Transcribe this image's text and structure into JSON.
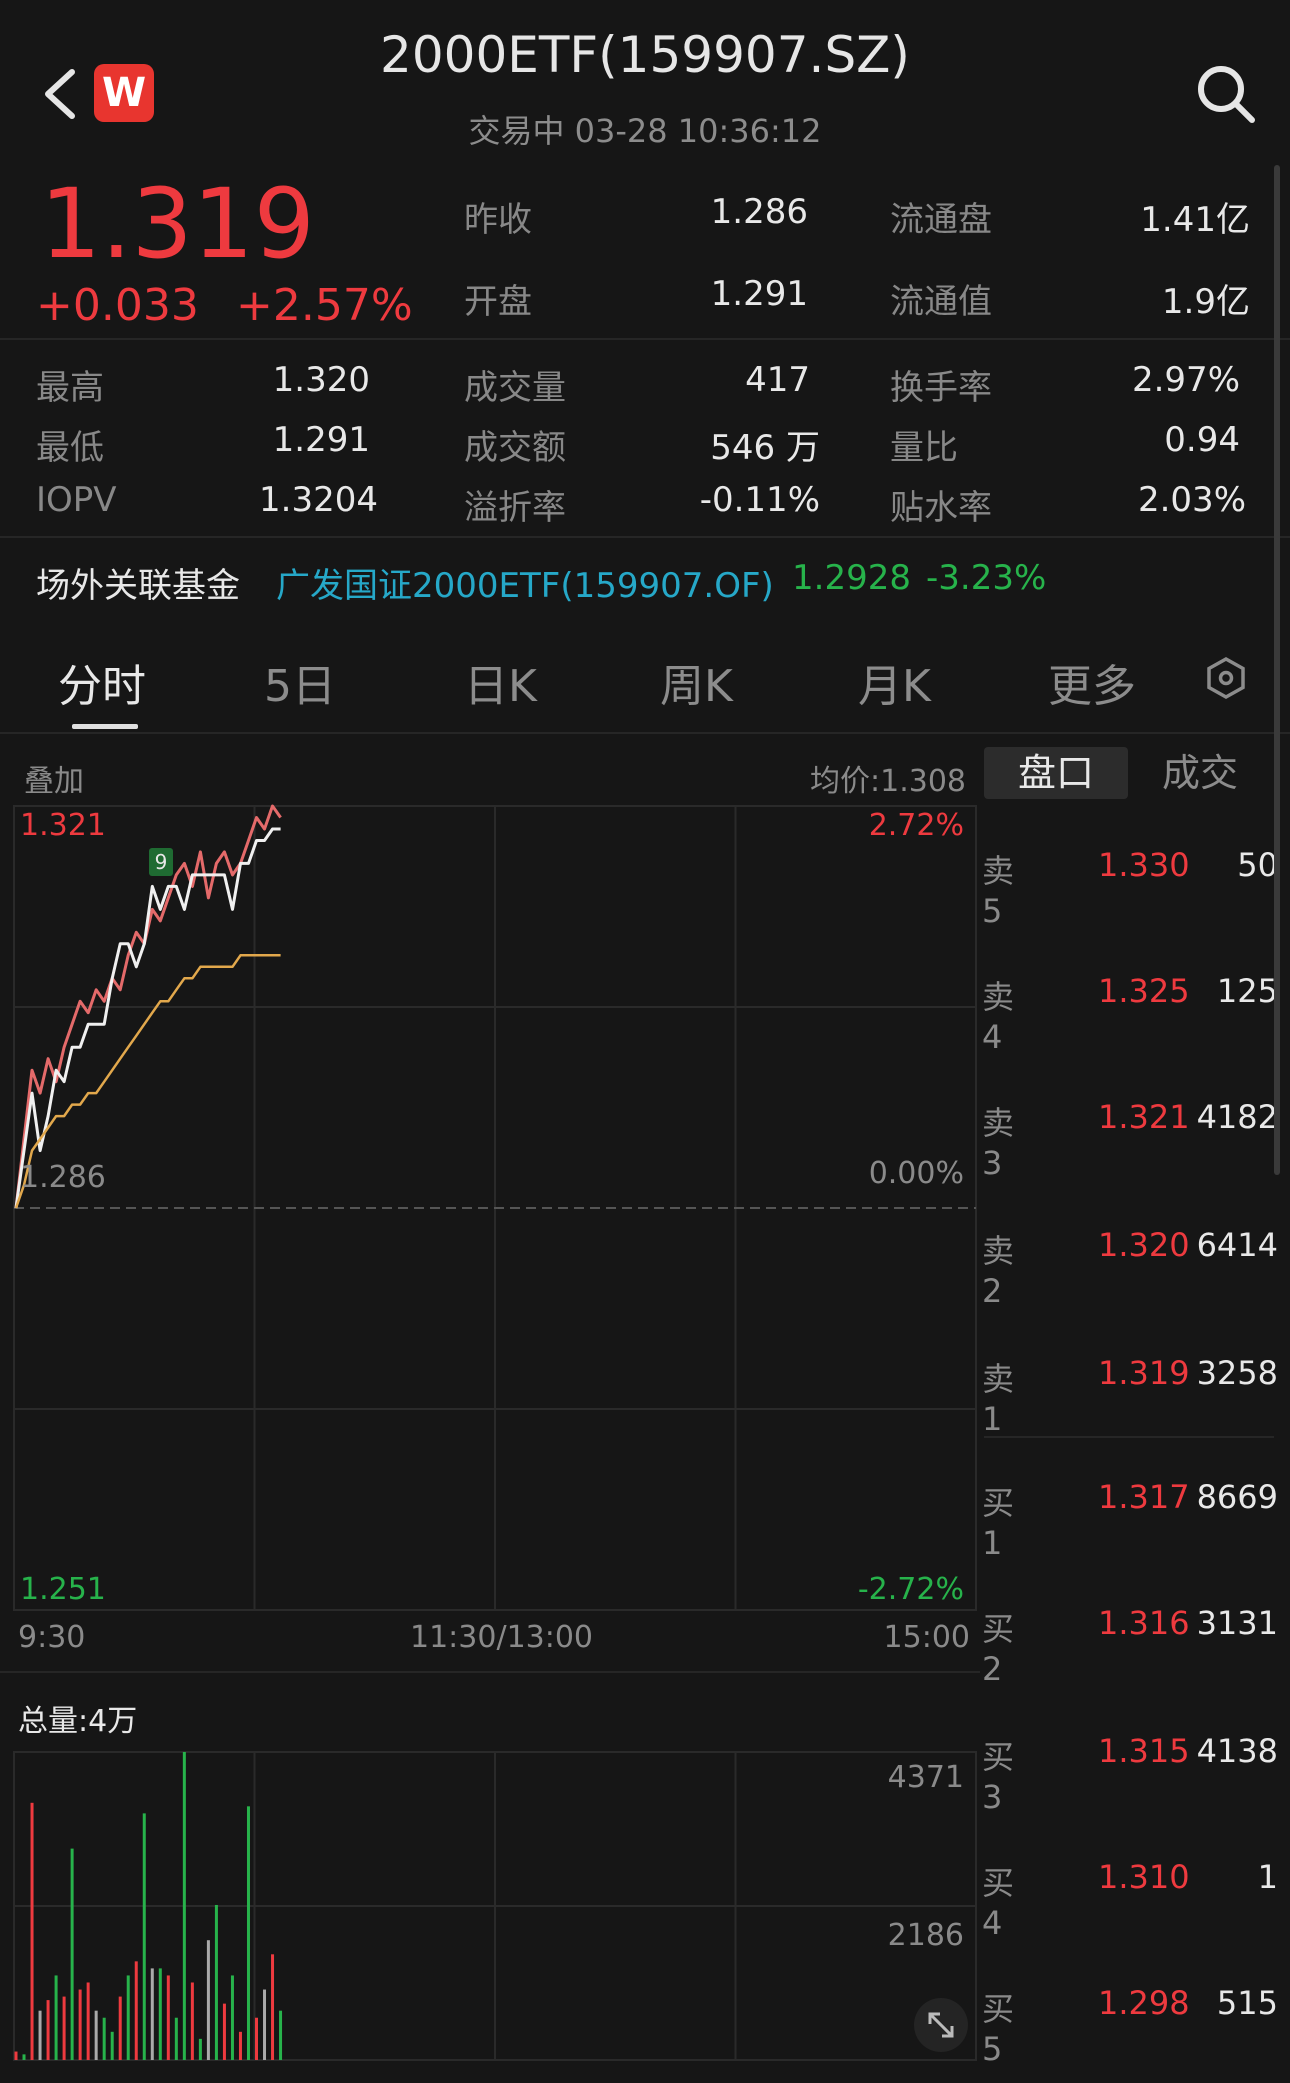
{
  "header": {
    "title": "2000ETF(159907.SZ)",
    "status": "交易中 03-28 10:36:12",
    "logo_letter": "W"
  },
  "quote": {
    "price": "1.319",
    "change": "+0.033",
    "change_pct": "+2.57%",
    "fields": [
      {
        "label": "昨收",
        "value": "1.286"
      },
      {
        "label": "开盘",
        "value": "1.291"
      },
      {
        "label": "流通盘",
        "value": "1.41亿"
      },
      {
        "label": "流通值",
        "value": "1.9亿"
      },
      {
        "label": "最高",
        "value": "1.320"
      },
      {
        "label": "最低",
        "value": "1.291"
      },
      {
        "label": "IOPV",
        "value": "1.3204"
      },
      {
        "label": "成交量",
        "value": "417"
      },
      {
        "label": "成交额",
        "value": "546 万"
      },
      {
        "label": "溢折率",
        "value": "-0.11%"
      },
      {
        "label": "换手率",
        "value": "2.97%"
      },
      {
        "label": "量比",
        "value": "0.94"
      },
      {
        "label": "贴水率",
        "value": "2.03%"
      }
    ]
  },
  "related_fund": {
    "label": "场外关联基金",
    "name": "广发国证2000ETF(159907.OF)",
    "nav": "1.2928",
    "change_pct": "-3.23%"
  },
  "tabs": [
    "分时",
    "5日",
    "日K",
    "周K",
    "月K",
    "更多"
  ],
  "chart": {
    "overlay_label": "叠加",
    "avg_price_label": "均价:1.308",
    "y_top": "1.321",
    "y_mid": "1.286",
    "y_bottom": "1.251",
    "pct_top": "2.72%",
    "pct_mid": "0.00%",
    "pct_bottom": "-2.72%",
    "marker": "9",
    "x_start": "9:30",
    "x_mid": "11:30/13:00",
    "x_end": "15:00",
    "volume_label": "总量:4万",
    "vol_max": "4371",
    "vol_mid": "2186"
  },
  "chart_data": {
    "type": "line",
    "ylim": [
      1.251,
      1.321
    ],
    "series": [
      {
        "values": [
          1.286,
          1.292,
          1.298,
          1.296,
          1.299,
          1.297,
          1.3,
          1.302,
          1.304,
          1.303,
          1.305,
          1.304,
          1.306,
          1.305,
          1.308,
          1.31,
          1.309,
          1.312,
          1.311,
          1.313,
          1.315,
          1.316,
          1.314,
          1.317,
          1.313,
          1.316,
          1.317,
          1.315,
          1.316,
          1.318,
          1.32,
          1.319,
          1.321,
          1.32
        ]
      },
      {
        "values": [
          1.286,
          1.291,
          1.296,
          1.291,
          1.294,
          1.298,
          1.297,
          1.3,
          1.3,
          1.302,
          1.302,
          1.302,
          1.306,
          1.309,
          1.309,
          1.307,
          1.309,
          1.314,
          1.312,
          1.314,
          1.314,
          1.312,
          1.315,
          1.315,
          1.315,
          1.315,
          1.315,
          1.312,
          1.316,
          1.316,
          1.318,
          1.318,
          1.319,
          1.319
        ]
      },
      {
        "values": [
          1.286,
          1.288,
          1.291,
          1.292,
          1.293,
          1.294,
          1.294,
          1.295,
          1.295,
          1.296,
          1.296,
          1.297,
          1.298,
          1.299,
          1.3,
          1.301,
          1.302,
          1.303,
          1.304,
          1.304,
          1.305,
          1.306,
          1.306,
          1.307,
          1.307,
          1.307,
          1.307,
          1.307,
          1.308,
          1.308,
          1.308,
          1.308,
          1.308,
          1.308
        ]
      }
    ],
    "volume": [
      120,
      80,
      3650,
      700,
      850,
      1200,
      900,
      3000,
      1000,
      1100,
      700,
      600,
      400,
      900,
      1200,
      1400,
      3500,
      1300,
      1300,
      1200,
      600,
      4371,
      1100,
      300,
      1700,
      2200,
      800,
      1200,
      400,
      3600,
      600,
      1000,
      1500,
      700
    ],
    "volume_colors": [
      "r",
      "g",
      "r",
      "g",
      "r",
      "g",
      "r",
      "g",
      "r",
      "r",
      "r",
      "g",
      "g",
      "r",
      "g",
      "r",
      "g",
      "r",
      "g",
      "r",
      "g",
      "g",
      "r",
      "g",
      "r",
      "g",
      "r",
      "g",
      "r",
      "g",
      "r",
      "g",
      "r",
      "g"
    ],
    "volume_ylim": [
      0,
      4371
    ]
  },
  "order_book": {
    "tabs": [
      "盘口",
      "成交"
    ],
    "rows": [
      {
        "label": "卖5",
        "price": "1.330",
        "vol": "50"
      },
      {
        "label": "卖4",
        "price": "1.325",
        "vol": "125"
      },
      {
        "label": "卖3",
        "price": "1.321",
        "vol": "4182"
      },
      {
        "label": "卖2",
        "price": "1.320",
        "vol": "6414"
      },
      {
        "label": "卖1",
        "price": "1.319",
        "vol": "3258"
      },
      {
        "label": "买1",
        "price": "1.317",
        "vol": "8669"
      },
      {
        "label": "买2",
        "price": "1.316",
        "vol": "3131"
      },
      {
        "label": "买3",
        "price": "1.315",
        "vol": "4138"
      },
      {
        "label": "买4",
        "price": "1.310",
        "vol": "1"
      },
      {
        "label": "买5",
        "price": "1.298",
        "vol": "515"
      }
    ]
  },
  "colors": {
    "up": "#ee3a3f",
    "down": "#27b34b",
    "price_line": "#f0f0f0",
    "avg_line": "#e2a84c",
    "price_line2": "#e46a6a"
  }
}
